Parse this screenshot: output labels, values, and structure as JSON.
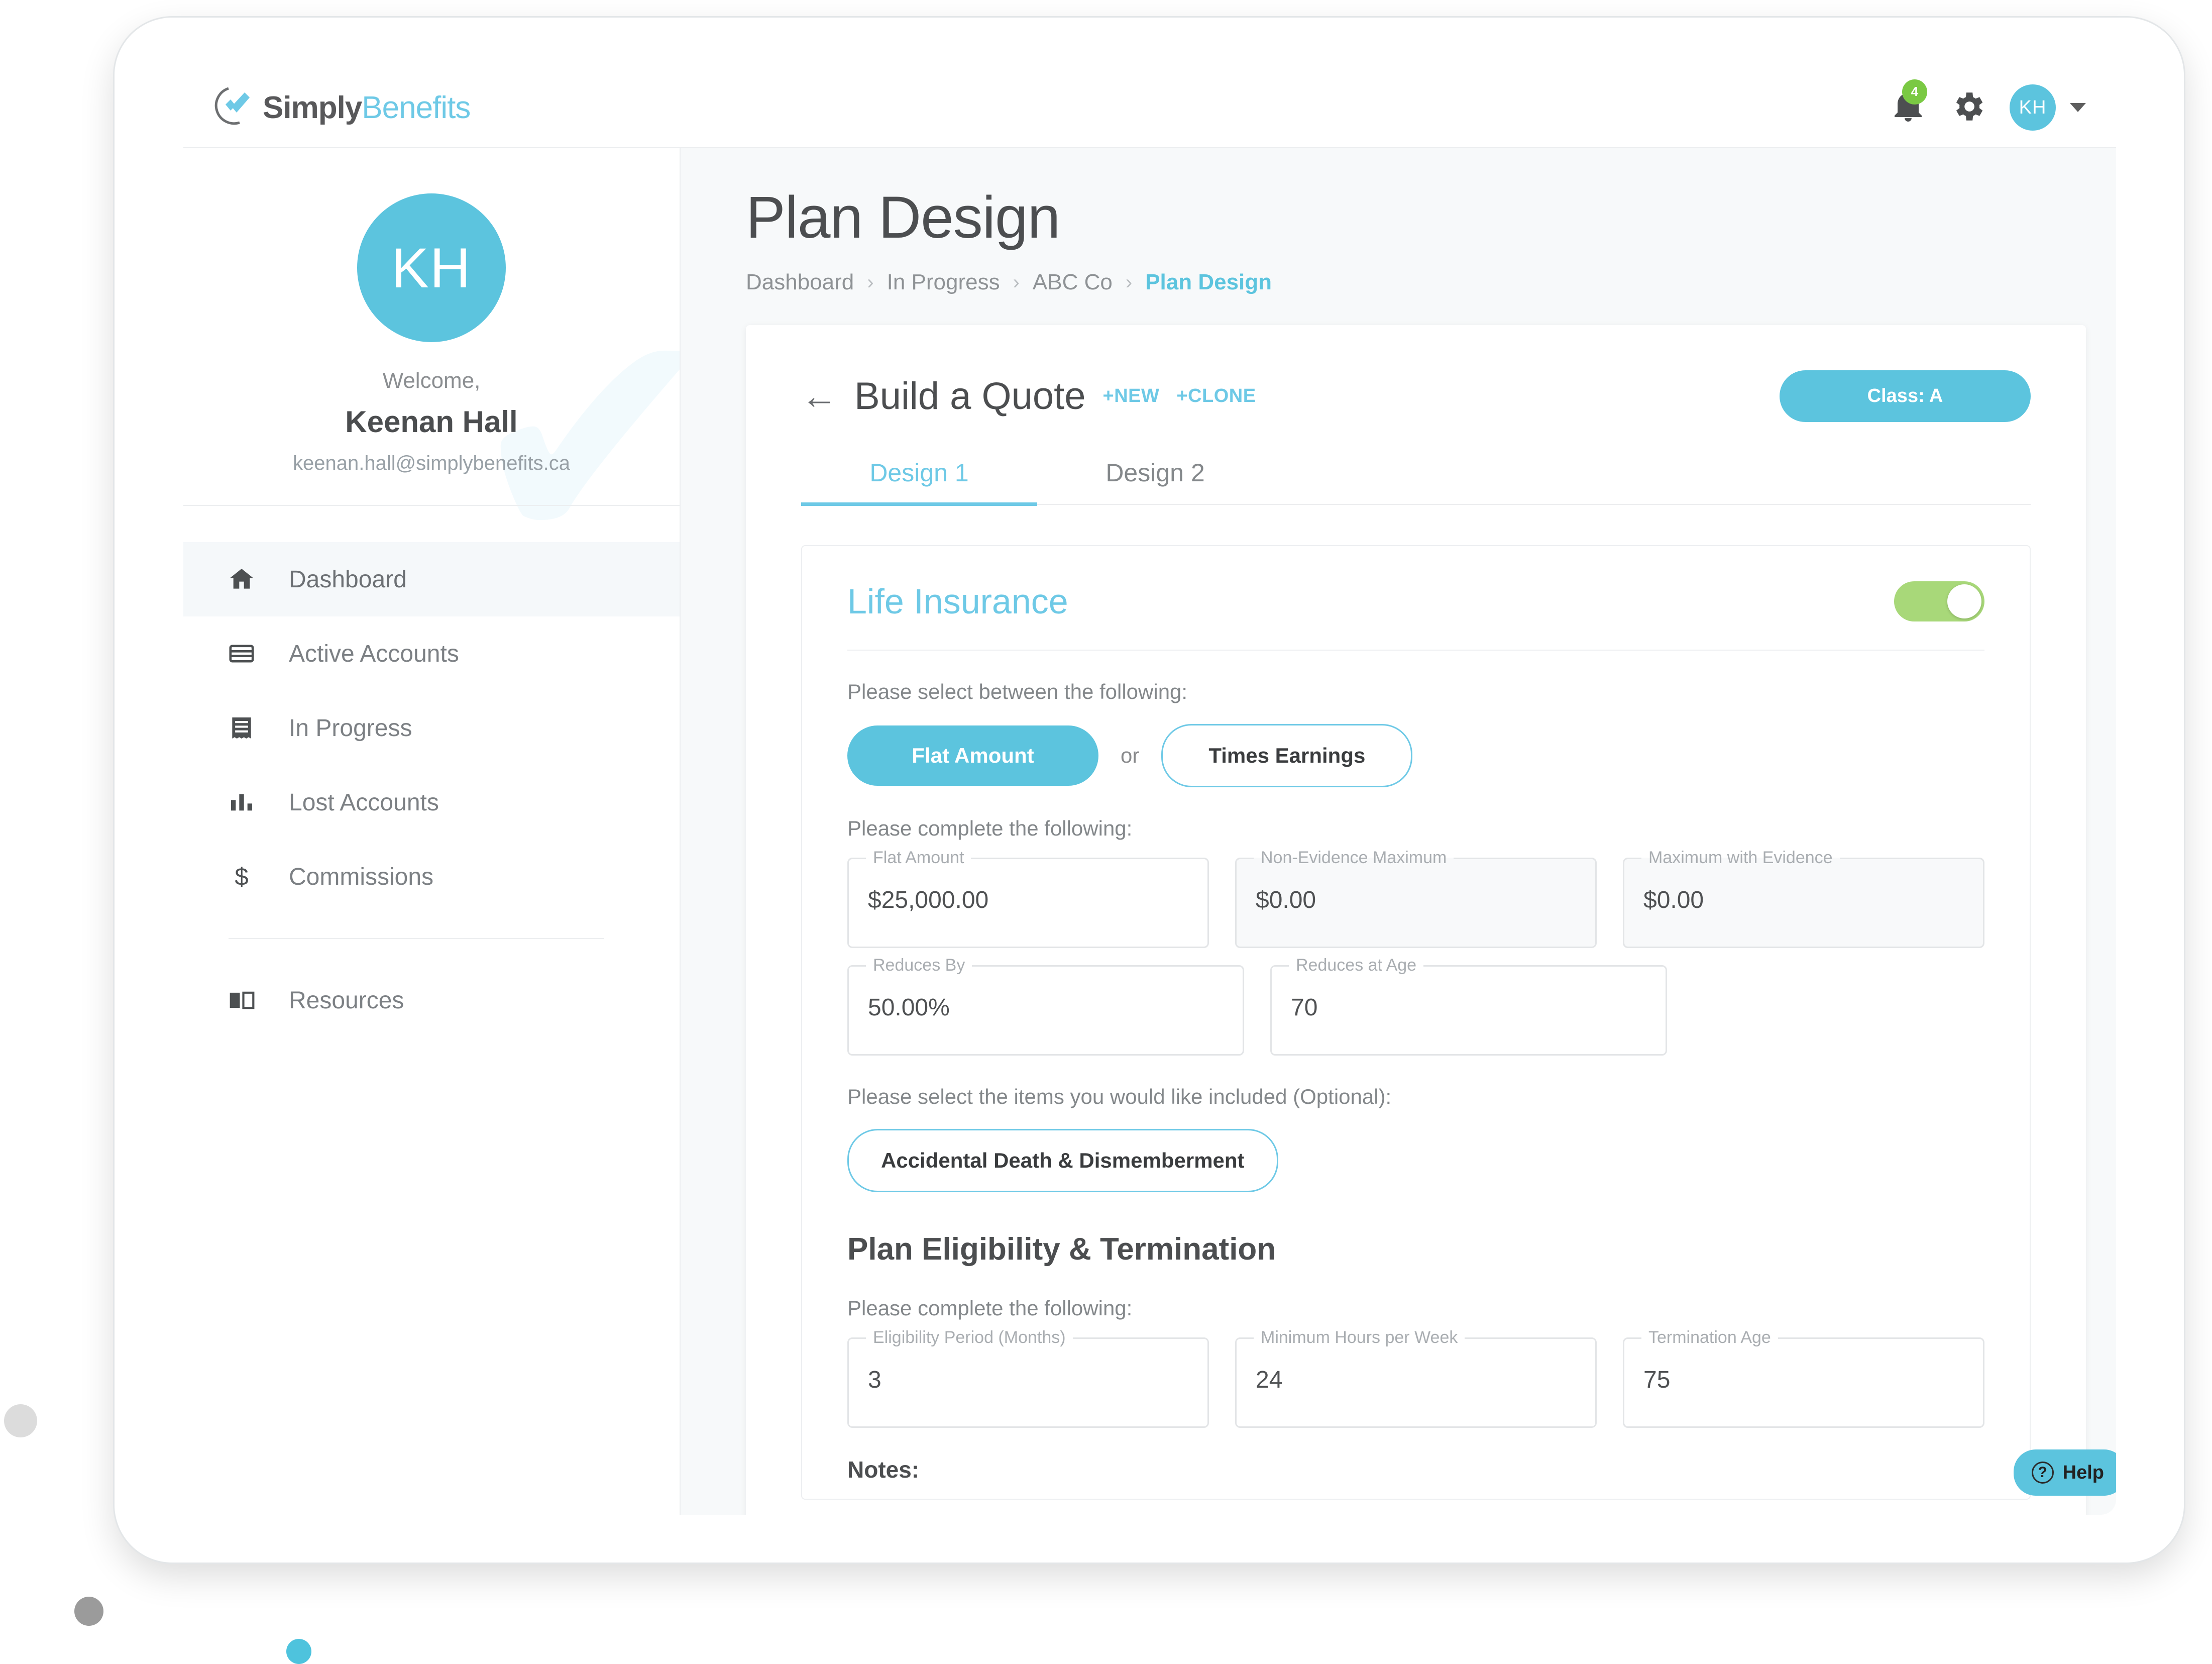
{
  "brand": {
    "logo_simply": "Simply",
    "logo_benefits": "Benefits",
    "accent_cyan": "#5cc4de",
    "accent_green": "#7ac943"
  },
  "topbar": {
    "notification_count": "4",
    "avatar_initials": "KH"
  },
  "sidebar": {
    "profile": {
      "avatar_initials": "KH",
      "welcome_label": "Welcome,",
      "name": "Keenan Hall",
      "email": "keenan.hall@simplybenefits.ca"
    },
    "items": [
      {
        "label": "Dashboard",
        "icon": "home-icon"
      },
      {
        "label": "Active Accounts",
        "icon": "credit-card-icon"
      },
      {
        "label": "In Progress",
        "icon": "receipt-icon"
      },
      {
        "label": "Lost Accounts",
        "icon": "bar-chart-icon"
      },
      {
        "label": "Commissions",
        "icon": "dollar-icon"
      }
    ],
    "secondary_items": [
      {
        "label": "Resources",
        "icon": "book-icon"
      }
    ]
  },
  "main": {
    "page_title": "Plan Design",
    "breadcrumb": [
      "Dashboard",
      "In Progress",
      "ABC Co",
      "Plan Design"
    ],
    "quote": {
      "back_arrow": "←",
      "title": "Build a Quote",
      "new_label": "+NEW",
      "clone_label": "+CLONE",
      "class_pill": "Class: A"
    },
    "tabs": [
      {
        "label": "Design 1",
        "active": true
      },
      {
        "label": "Design 2",
        "active": false
      }
    ],
    "life_insurance": {
      "title": "Life Insurance",
      "toggle_on": true,
      "select_hint": "Please select between the following:",
      "option_primary": "Flat Amount",
      "option_or": "or",
      "option_secondary": "Times Earnings",
      "complete_hint": "Please complete the following:",
      "fields_row1": [
        {
          "label": "Flat Amount",
          "value": "$25,000.00",
          "muted": false
        },
        {
          "label": "Non-Evidence Maximum",
          "value": "$0.00",
          "muted": true
        },
        {
          "label": "Maximum with Evidence",
          "value": "$0.00",
          "muted": true
        }
      ],
      "fields_row2": [
        {
          "label": "Reduces By",
          "value": "50.00%",
          "muted": false
        },
        {
          "label": "Reduces at Age",
          "value": "70",
          "muted": false
        }
      ],
      "optional_hint": "Please select the items you would like included (Optional):",
      "optional_items": [
        "Accidental Death & Dismemberment"
      ]
    },
    "eligibility": {
      "title": "Plan Eligibility & Termination",
      "complete_hint": "Please complete the following:",
      "fields": [
        {
          "label": "Eligibility Period (Months)",
          "value": "3",
          "muted": false
        },
        {
          "label": "Minimum Hours per Week",
          "value": "24",
          "muted": false
        },
        {
          "label": "Termination Age",
          "value": "75",
          "muted": false
        }
      ],
      "notes_label": "Notes:"
    },
    "help_button": "Help"
  }
}
